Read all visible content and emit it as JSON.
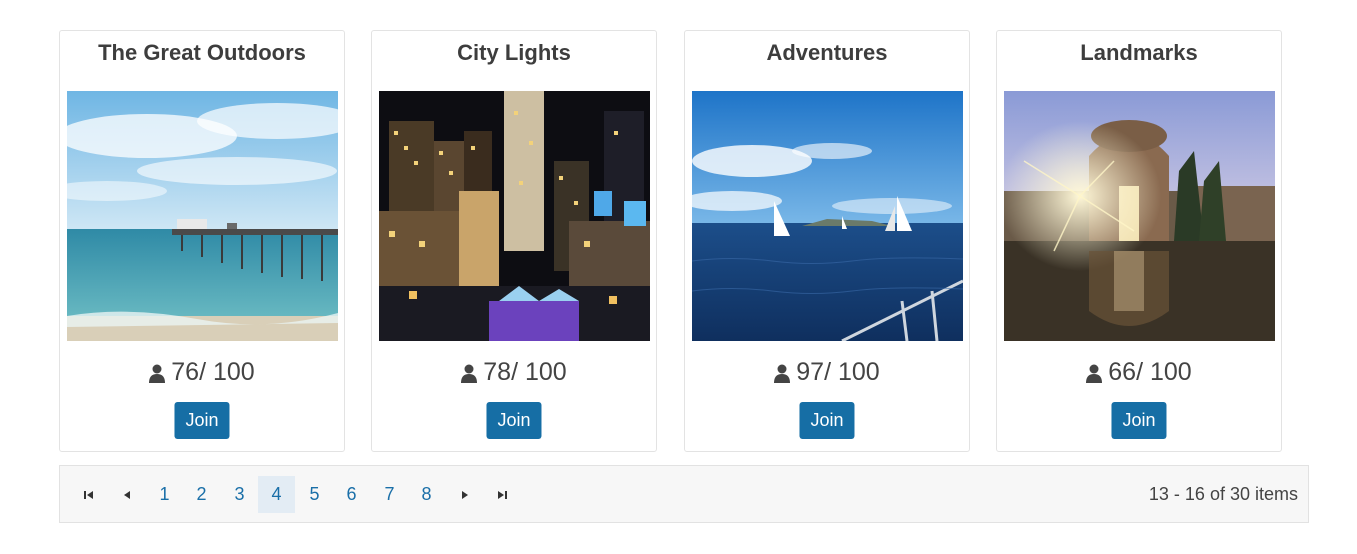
{
  "cards": [
    {
      "title": "The Great Outdoors",
      "count": "76",
      "capacity": "/ 100",
      "join_label": "Join",
      "icon": "person-icon"
    },
    {
      "title": "City Lights",
      "count": "78",
      "capacity": "/ 100",
      "join_label": "Join",
      "icon": "person-icon"
    },
    {
      "title": "Adventures",
      "count": "97",
      "capacity": "/ 100",
      "join_label": "Join",
      "icon": "person-icon"
    },
    {
      "title": "Landmarks",
      "count": "66",
      "capacity": "/ 100",
      "join_label": "Join",
      "icon": "person-icon"
    }
  ],
  "pager": {
    "pages": [
      "1",
      "2",
      "3",
      "4",
      "5",
      "6",
      "7",
      "8"
    ],
    "current": "4",
    "info": "13 - 16 of 30 items",
    "icons": [
      "first-page-icon",
      "prev-page-icon",
      "next-page-icon",
      "last-page-icon"
    ]
  },
  "colors": {
    "button": "#166ea5",
    "link": "#1a6fa8",
    "active_page_bg": "#e3ecf4",
    "pager_bg": "#f7f7f7"
  }
}
